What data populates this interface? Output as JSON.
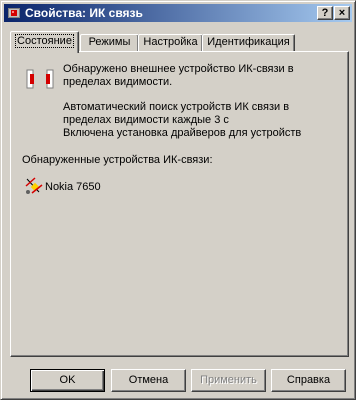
{
  "window": {
    "title": "Свойства: ИК связь",
    "help_button": "?",
    "close_button": "×",
    "title_icon": "infrared-icon"
  },
  "tabs": [
    {
      "label": "Состояние",
      "active": true
    },
    {
      "label": "Режимы",
      "active": false
    },
    {
      "label": "Настройка",
      "active": false
    },
    {
      "label": "Идентификация",
      "active": false
    }
  ],
  "status": {
    "icon": "infrared-link-icon",
    "line1": "Обнаружено внешнее устройство ИК-связи в пределах видимости.",
    "line2": "Автоматический поиск устройств ИК связи в пределах видимости каждые 3 с",
    "line3": "Включена установка драйверов для устройств"
  },
  "devices": {
    "label": "Обнаруженные устройства ИК-связи:",
    "items": [
      {
        "name": "Nokia 7650",
        "icon": "phone-satellite-icon"
      }
    ]
  },
  "buttons": {
    "ok": "OK",
    "cancel": "Отмена",
    "apply": "Применить",
    "help": "Справка"
  },
  "colors": {
    "face": "#d4d0c8",
    "title_start": "#0a246a",
    "title_end": "#a6caf0",
    "ir_red": "#d40000"
  }
}
